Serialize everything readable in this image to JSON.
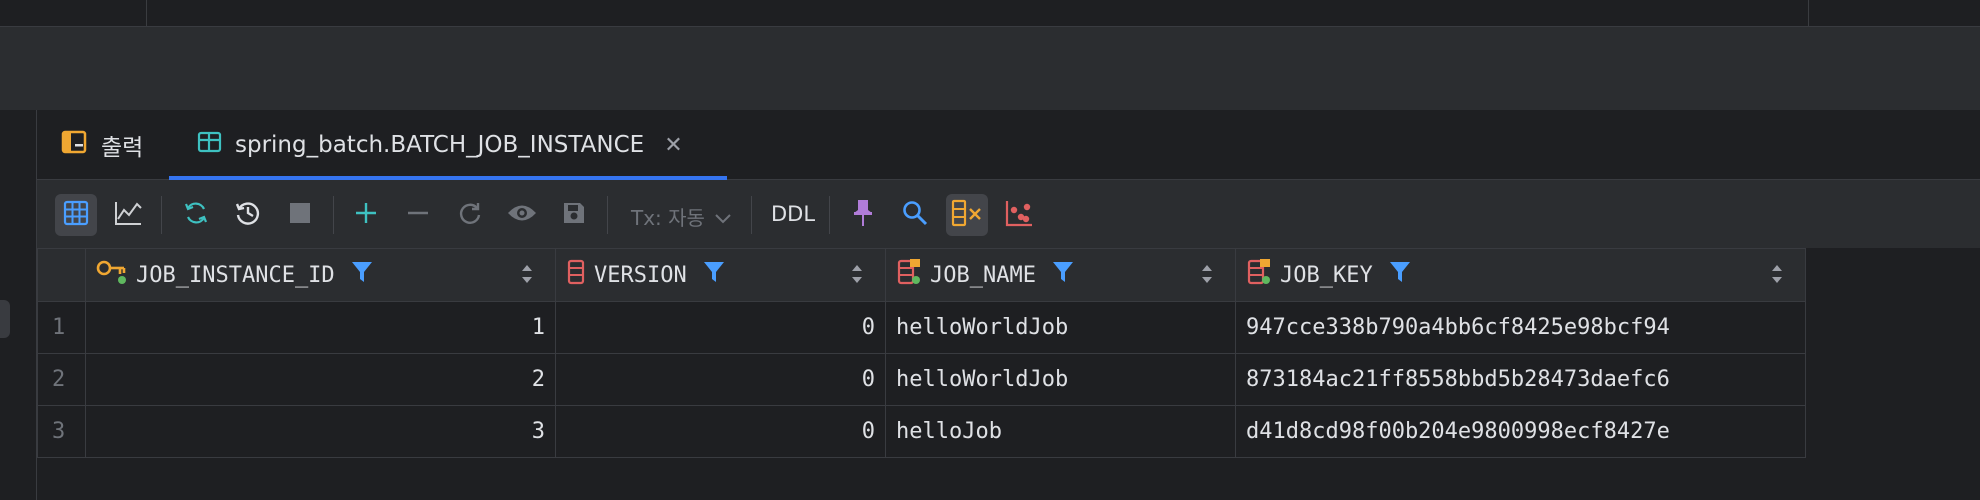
{
  "tabs": [
    {
      "label": "출력",
      "icon": "output-icon"
    },
    {
      "label": "spring_batch.BATCH_JOB_INSTANCE",
      "icon": "table-icon",
      "active": true
    }
  ],
  "toolbar": {
    "tx_label": "Tx: 자동",
    "ddl_label": "DDL"
  },
  "grid": {
    "columns": [
      {
        "name": "JOB_INSTANCE_ID",
        "icon": "primary-key-icon"
      },
      {
        "name": "VERSION",
        "icon": "column-icon"
      },
      {
        "name": "JOB_NAME",
        "icon": "column-index-icon"
      },
      {
        "name": "JOB_KEY",
        "icon": "column-index-icon"
      }
    ],
    "rows": [
      {
        "n": "1",
        "id": "1",
        "version": "0",
        "job_name": "helloWorldJob",
        "job_key": "947cce338b790a4bb6cf8425e98bcf94"
      },
      {
        "n": "2",
        "id": "2",
        "version": "0",
        "job_name": "helloWorldJob",
        "job_key": "873184ac21ff8558bbd5b28473daefc6"
      },
      {
        "n": "3",
        "id": "3",
        "version": "0",
        "job_name": "helloJob",
        "job_key": "d41d8cd98f00b204e9800998ecf8427e"
      }
    ]
  },
  "colors": {
    "accent": "#3574f0",
    "filter": "#4a9eff",
    "orange": "#f0a732",
    "teal": "#3ec1c1"
  }
}
